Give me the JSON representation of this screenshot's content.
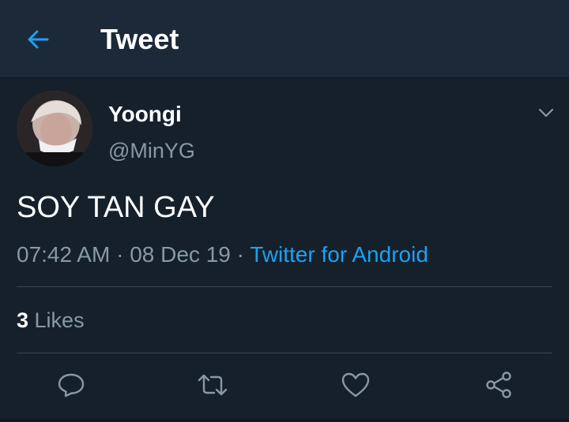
{
  "header": {
    "title": "Tweet",
    "back_icon": "arrow-left-icon"
  },
  "tweet": {
    "author": {
      "display_name": "Yoongi",
      "handle": "@MinYG"
    },
    "text": "SOY TAN GAY",
    "time": "07:42 AM",
    "separator1": " · ",
    "date": "08 Dec 19",
    "separator2": " · ",
    "source": "Twitter for Android",
    "likes": {
      "count": "3",
      "label": " Likes"
    }
  },
  "actions": [
    {
      "name": "reply",
      "icon": "comment-icon"
    },
    {
      "name": "retweet",
      "icon": "retweet-icon"
    },
    {
      "name": "like",
      "icon": "heart-icon"
    },
    {
      "name": "share",
      "icon": "share-icon"
    }
  ],
  "colors": {
    "background": "#15202b",
    "header": "#1c2938",
    "accent": "#1da1f2",
    "secondary_text": "#8899a6",
    "divider": "#38444d"
  }
}
